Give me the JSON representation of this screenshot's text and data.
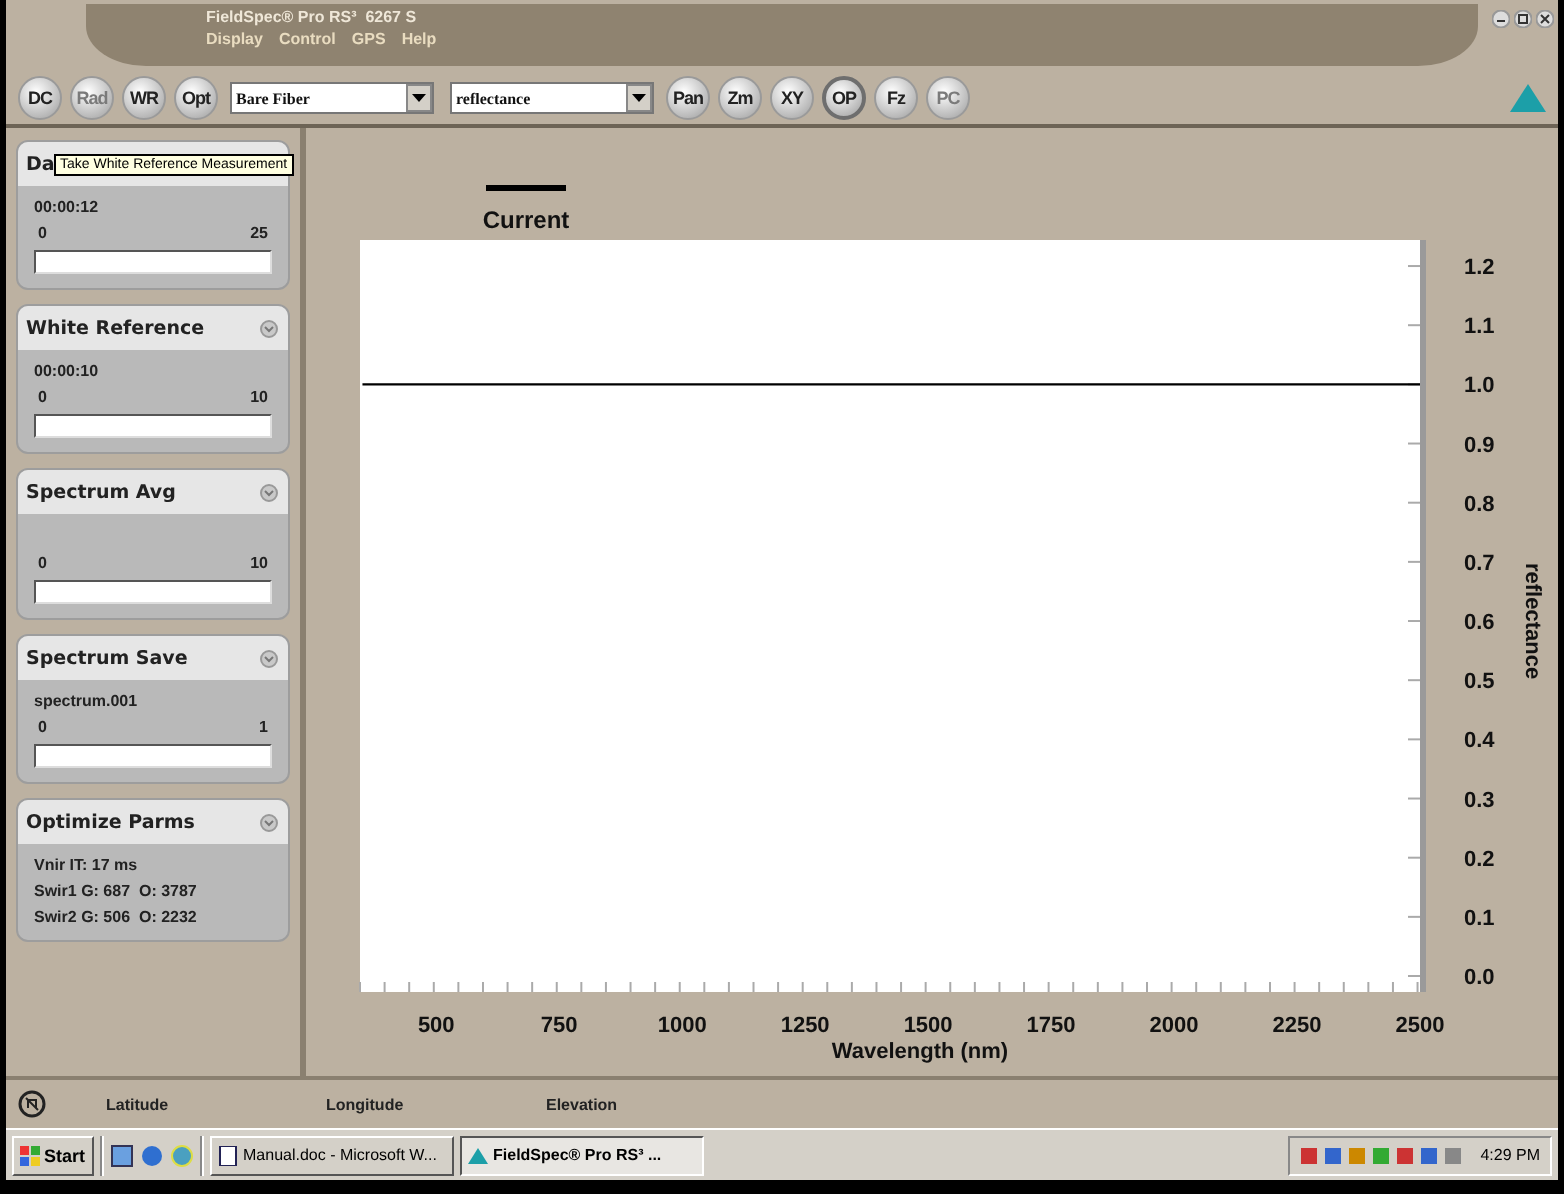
{
  "window": {
    "title": "FieldSpec® Pro RS³  6267 S"
  },
  "menu": [
    "Display",
    "Control",
    "GPS",
    "Help"
  ],
  "toolbar": [
    {
      "kind": "button",
      "label": "DC",
      "disabled": false,
      "selected": false
    },
    {
      "kind": "button",
      "label": "Rad",
      "disabled": true,
      "selected": false
    },
    {
      "kind": "button",
      "label": "WR",
      "disabled": false,
      "selected": false
    },
    {
      "kind": "button",
      "label": "Opt",
      "disabled": false,
      "selected": false
    },
    {
      "kind": "dropdown",
      "value": "Bare Fiber"
    },
    {
      "kind": "dropdown",
      "value": "reflectance"
    },
    {
      "kind": "button",
      "label": "Pan",
      "disabled": false,
      "selected": false
    },
    {
      "kind": "button",
      "label": "Zm",
      "disabled": false,
      "selected": false
    },
    {
      "kind": "button",
      "label": "XY",
      "disabled": false,
      "selected": false
    },
    {
      "kind": "button",
      "label": "OP",
      "disabled": false,
      "selected": true
    },
    {
      "kind": "button",
      "label": "Fz",
      "disabled": false,
      "selected": false
    },
    {
      "kind": "button",
      "label": "PC",
      "disabled": true,
      "selected": false
    }
  ],
  "tooltip": {
    "text": "Take White Reference Measurement"
  },
  "panels": [
    {
      "kind": "progress",
      "title": "Da",
      "timer": "00:00:12",
      "min": "0",
      "max": "25"
    },
    {
      "kind": "progress",
      "title": "White Reference",
      "timer": "00:00:10",
      "min": "0",
      "max": "10"
    },
    {
      "kind": "progress",
      "title": "Spectrum Avg",
      "min": "0",
      "max": "10"
    },
    {
      "kind": "progress",
      "title": "Spectrum Save",
      "timer": "spectrum.001",
      "min": "0",
      "max": "1"
    },
    {
      "kind": "info",
      "title": "Optimize Parms",
      "lines": [
        "Vnir IT: 17 ms",
        "Swir1 G: 687  O: 3787",
        "Swir2 G: 506  O: 2232"
      ]
    }
  ],
  "chart_data": {
    "type": "line",
    "xlabel": "Wavelength (nm)",
    "ylabel": "reflectance",
    "x": [
      350,
      2500
    ],
    "series": [
      {
        "name": "Current",
        "color": "#000000",
        "values": [
          1.0,
          1.0
        ]
      }
    ],
    "xlim": [
      345,
      2500
    ],
    "ylim": [
      -0.027,
      1.244
    ],
    "xticks": [
      500,
      750,
      1000,
      1250,
      1500,
      1750,
      2000,
      2250,
      2500
    ],
    "yticks": [
      {
        "value": 0,
        "label": "0.0"
      },
      {
        "value": 0.1,
        "label": "0.1"
      },
      {
        "value": 0.2,
        "label": "0.2"
      },
      {
        "value": 0.3,
        "label": "0.3"
      },
      {
        "value": 0.4,
        "label": "0.4"
      },
      {
        "value": 0.5,
        "label": "0.5"
      },
      {
        "value": 0.6,
        "label": "0.6"
      },
      {
        "value": 0.7,
        "label": "0.7"
      },
      {
        "value": 0.8,
        "label": "0.8"
      },
      {
        "value": 0.9,
        "label": "0.9"
      },
      {
        "value": 1,
        "label": "1.0"
      },
      {
        "value": 1.1,
        "label": "1.1"
      },
      {
        "value": 1.2,
        "label": "1.2"
      }
    ]
  },
  "status_bar": [
    "Latitude",
    "Longitude",
    "Elevation"
  ],
  "taskbar": {
    "start": "Start",
    "tasks": [
      {
        "label": "Manual.doc - Microsoft W...",
        "selected": false
      },
      {
        "label": "FieldSpec® Pro RS³  ...",
        "selected": true
      }
    ],
    "clock": "4:29 PM"
  }
}
